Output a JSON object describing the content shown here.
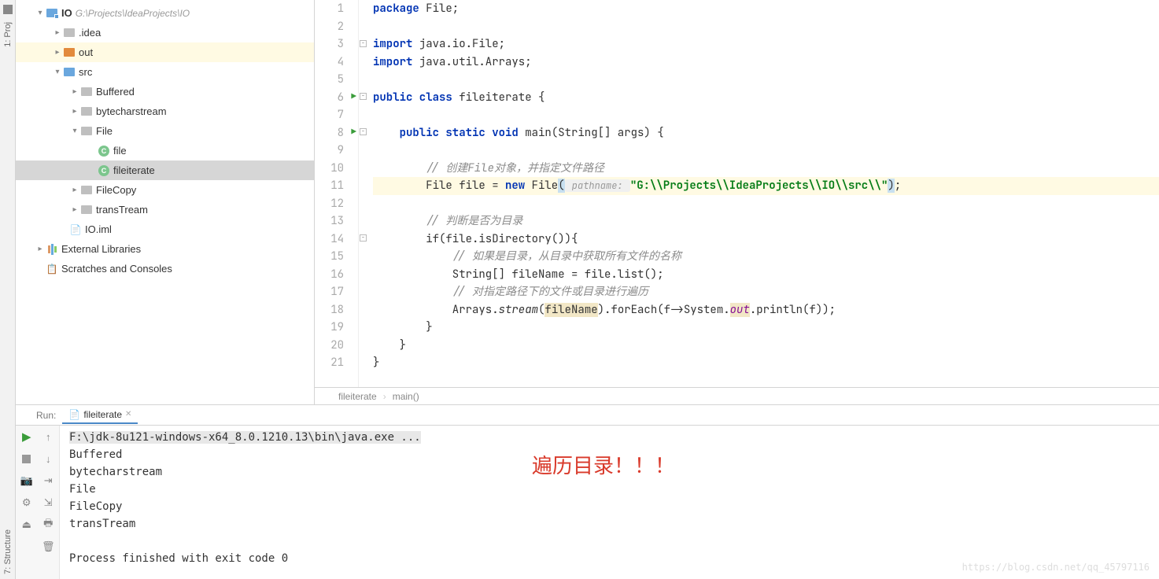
{
  "sidebar": {
    "proj_label": "1: Proj",
    "struct_label": "7: Structure"
  },
  "tree": {
    "root": {
      "name": "IO",
      "path": "G:\\Projects\\IdeaProjects\\IO"
    },
    "idea": ".idea",
    "out": "out",
    "src": "src",
    "buffered": "Buffered",
    "bytecharstream": "bytecharstream",
    "file_pkg": "File",
    "file_cls": "file",
    "fileiterate_cls": "fileiterate",
    "filecopy": "FileCopy",
    "transtream": "transTream",
    "iml": "IO.iml",
    "ext_libs": "External Libraries",
    "scratches": "Scratches and Consoles"
  },
  "code": {
    "lines": {
      "1": "package",
      "1b": " File;",
      "3a": "import",
      "3b": " java.io.File;",
      "4a": "import",
      "4b": " java.util.Arrays;",
      "6a": "public class",
      "6b": " fileiterate {",
      "8a": "    public static void",
      "8b": " main(String[] args) {",
      "10": "        // 创建File对象，并指定文件路径",
      "11a": "        File file = ",
      "11b": "new",
      "11c": " File",
      "11d": "(",
      "11hint": " pathname: ",
      "11e": "\"G:\\\\Projects\\\\IdeaProjects\\\\IO\\\\src\\\\\"",
      "11f": ")",
      "11g": ";",
      "13": "        // 判断是否为目录",
      "14": "        if(file.isDirectory()){",
      "15": "            // 如果是目录，从目录中获取所有文件的名称",
      "16": "            String[] fileName = file.list();",
      "17": "            // 对指定路径下的文件或目录进行遍历",
      "18a": "            Arrays.",
      "18b": "stream",
      "18c": "(",
      "18d": "fileName",
      "18e": ").forEach(f->System.",
      "18f": "out",
      "18g": ".println(f));",
      "19": "        }",
      "20": "    }",
      "21": "}"
    }
  },
  "breadcrumb": {
    "a": "fileiterate",
    "b": "main()"
  },
  "run": {
    "label": "Run:",
    "tab": "fileiterate",
    "cmd": "F:\\jdk-8u121-windows-x64_8.0.1210.13\\bin\\java.exe ...",
    "out1": "Buffered",
    "out2": "bytecharstream",
    "out3": "File",
    "out4": "FileCopy",
    "out5": "transTream",
    "exit": "Process finished with exit code 0"
  },
  "overlay": "遍历目录！！！",
  "watermark": "https://blog.csdn.net/qq_45797116"
}
